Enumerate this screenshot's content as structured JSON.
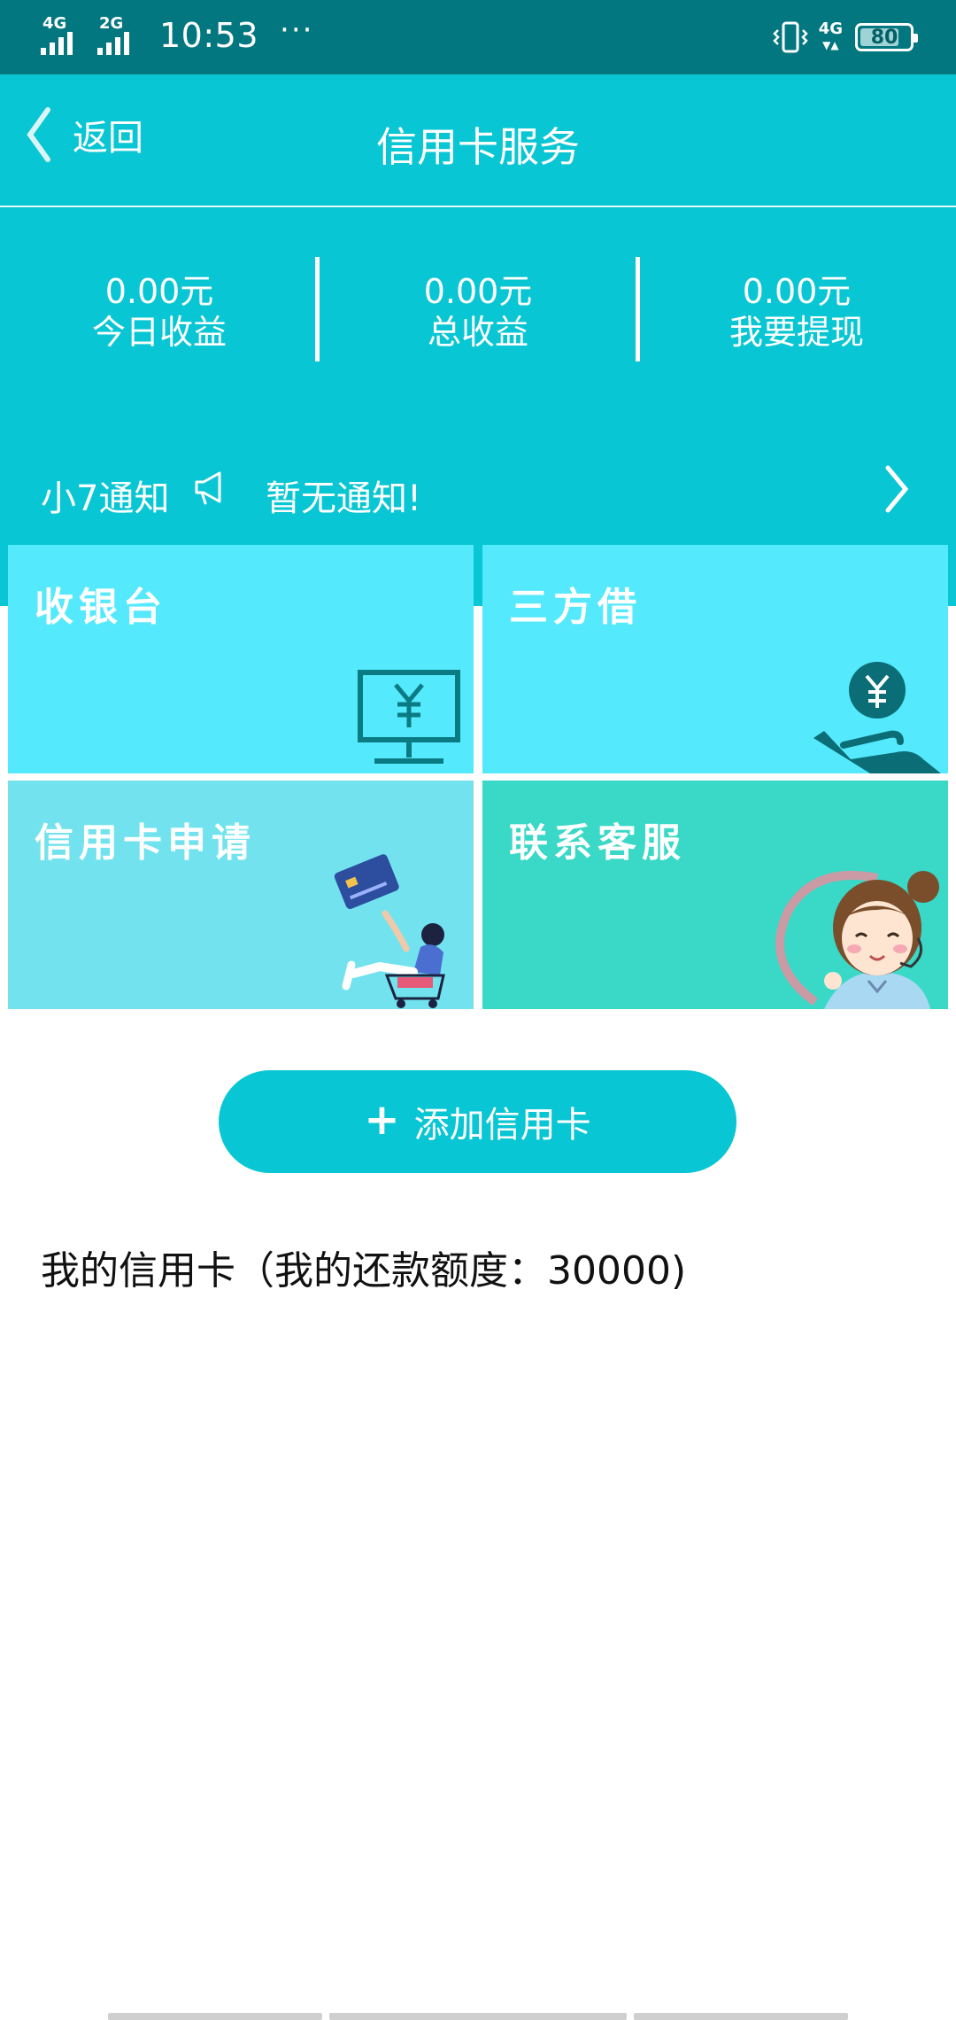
{
  "status_bar": {
    "sim1_network": "4G",
    "sim2_network": "2G",
    "time": "10:53",
    "more_dots": "···",
    "data_network": "4G",
    "battery_percent": "80",
    "battery_level": 0.8
  },
  "nav": {
    "back_label": "返回",
    "title": "信用卡服务"
  },
  "stats": [
    {
      "value": "0.00元",
      "label": "今日收益"
    },
    {
      "value": "0.00元",
      "label": "总收益"
    },
    {
      "value": "0.00元",
      "label": "我要提现"
    }
  ],
  "notice": {
    "label": "小7通知",
    "message": "暂无通知!"
  },
  "tiles": [
    {
      "label": "收银台",
      "icon": "monitor-yuan-icon"
    },
    {
      "label": "三方借",
      "icon": "hand-coin-icon"
    },
    {
      "label": "信用卡申请",
      "icon": "shopping-girl-card-illustration"
    },
    {
      "label": "联系客服",
      "icon": "customer-service-girl-illustration"
    }
  ],
  "add_card_button": {
    "icon": "plus-icon",
    "label": "添加信用卡"
  },
  "my_cards": {
    "title": "我的信用卡（我的还款额度：30000)"
  },
  "colors": {
    "status_bar": "#037780",
    "header": "#08c6d3",
    "tile_light": "#54e9fc",
    "tile_apply": "#72e3ee",
    "tile_service": "#39d8c7"
  }
}
